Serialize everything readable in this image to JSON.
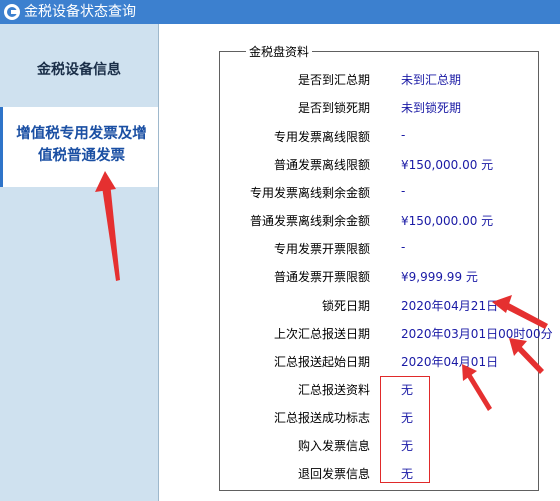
{
  "window": {
    "title": "金税设备状态查询",
    "icon": "app-logo-icon"
  },
  "sidebar": {
    "items": [
      {
        "label": "金税设备信息"
      },
      {
        "label_line1": "增值税专用发票及增",
        "label_line2": "值税普通发票"
      }
    ]
  },
  "panel": {
    "legend": "金税盘资料",
    "rows": [
      {
        "label": "是否到汇总期",
        "value": "未到汇总期"
      },
      {
        "label": "是否到锁死期",
        "value": "未到锁死期"
      },
      {
        "label": "专用发票离线限额",
        "value": "-"
      },
      {
        "label": "普通发票离线限额",
        "value": "¥150,000.00 元"
      },
      {
        "label": "专用发票离线剩余金额",
        "value": "-"
      },
      {
        "label": "普通发票离线剩余金额",
        "value": "¥150,000.00 元"
      },
      {
        "label": "专用发票开票限额",
        "value": "-"
      },
      {
        "label": "普通发票开票限额",
        "value": "¥9,999.99 元"
      },
      {
        "label": "锁死日期",
        "value": "2020年04月21日"
      },
      {
        "label": "上次汇总报送日期",
        "value": "2020年03月01日00时00分"
      },
      {
        "label": "汇总报送起始日期",
        "value": "2020年04月01日"
      },
      {
        "label": "汇总报送资料",
        "value": "无"
      },
      {
        "label": "汇总报送成功标志",
        "value": "无"
      },
      {
        "label": "购入发票信息",
        "value": "无"
      },
      {
        "label": "退回发票信息",
        "value": "无"
      }
    ]
  },
  "colors": {
    "titlebar": "#3c80cf",
    "sidebar": "#cfe1ef",
    "value_text": "#1a1aa5",
    "annotation": "#e02a2a"
  }
}
